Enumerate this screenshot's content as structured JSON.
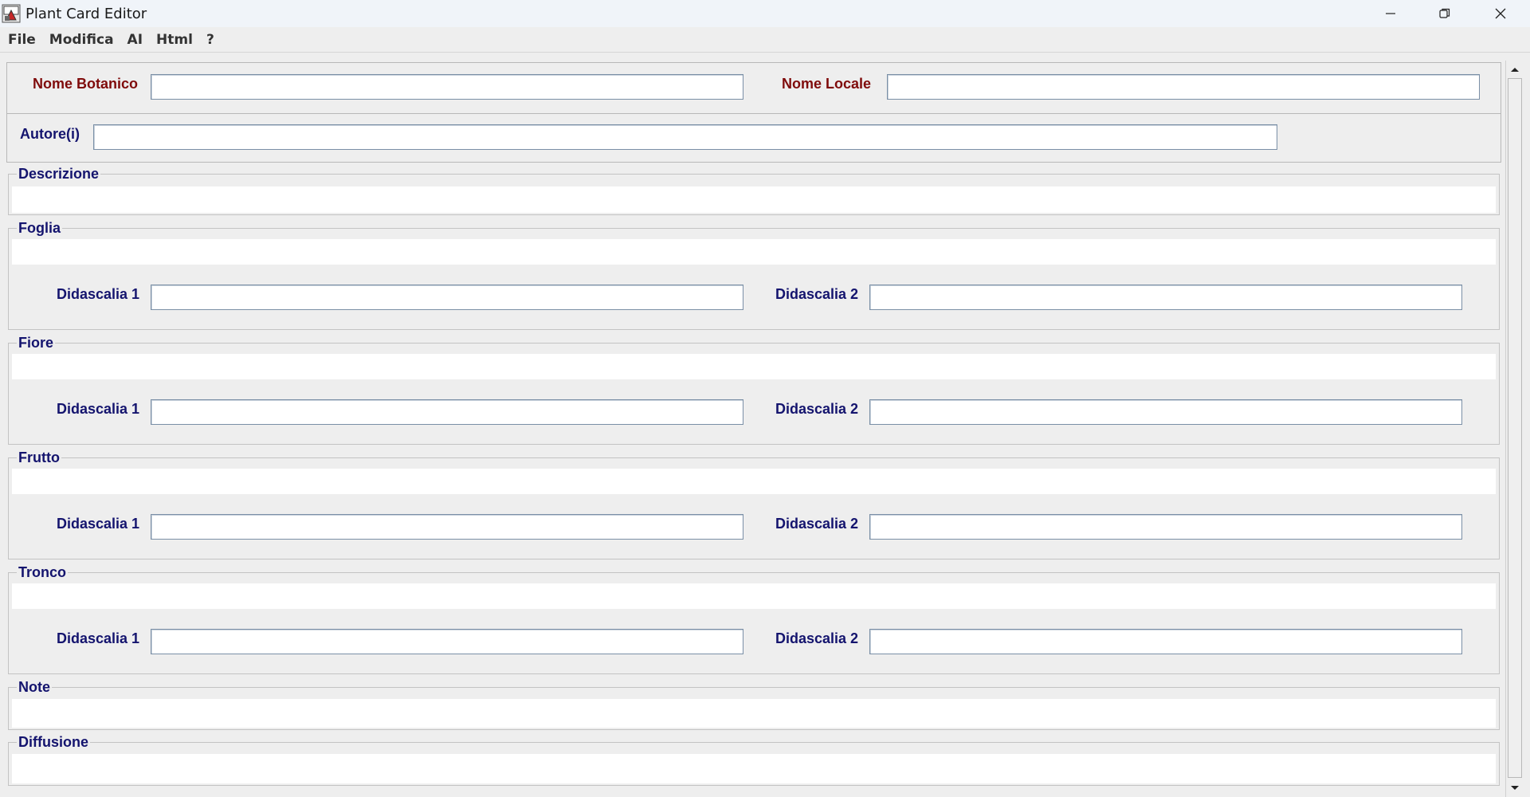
{
  "window": {
    "title": "Plant Card Editor",
    "icon": "app-plant-icon",
    "controls": [
      "minimize-icon",
      "restore-icon",
      "close-icon"
    ]
  },
  "menu": {
    "items": [
      "File",
      "Modifica",
      "AI",
      "Html",
      "?"
    ]
  },
  "header": {
    "botanical_name_label": "Nome Botanico",
    "botanical_name_value": "",
    "local_name_label": "Nome Locale",
    "local_name_value": "",
    "authors_label": "Autore(i)",
    "authors_value": ""
  },
  "sections": {
    "descrizione": {
      "title": "Descrizione",
      "value": ""
    },
    "foglia": {
      "title": "Foglia",
      "value": "",
      "caption1_label": "Didascalia 1",
      "caption1_value": "",
      "caption2_label": "Didascalia 2",
      "caption2_value": ""
    },
    "fiore": {
      "title": "Fiore",
      "value": "",
      "caption1_label": "Didascalia 1",
      "caption1_value": "",
      "caption2_label": "Didascalia 2",
      "caption2_value": ""
    },
    "frutto": {
      "title": "Frutto",
      "value": "",
      "caption1_label": "Didascalia 1",
      "caption1_value": "",
      "caption2_label": "Didascalia 2",
      "caption2_value": ""
    },
    "tronco": {
      "title": "Tronco",
      "value": "",
      "caption1_label": "Didascalia 1",
      "caption1_value": "",
      "caption2_label": "Didascalia 2",
      "caption2_value": ""
    },
    "note": {
      "title": "Note",
      "value": ""
    },
    "diffusione": {
      "title": "Diffusione",
      "value": ""
    }
  },
  "colors": {
    "primary_label": "#7f0b0b",
    "secondary_label": "#14146e"
  }
}
